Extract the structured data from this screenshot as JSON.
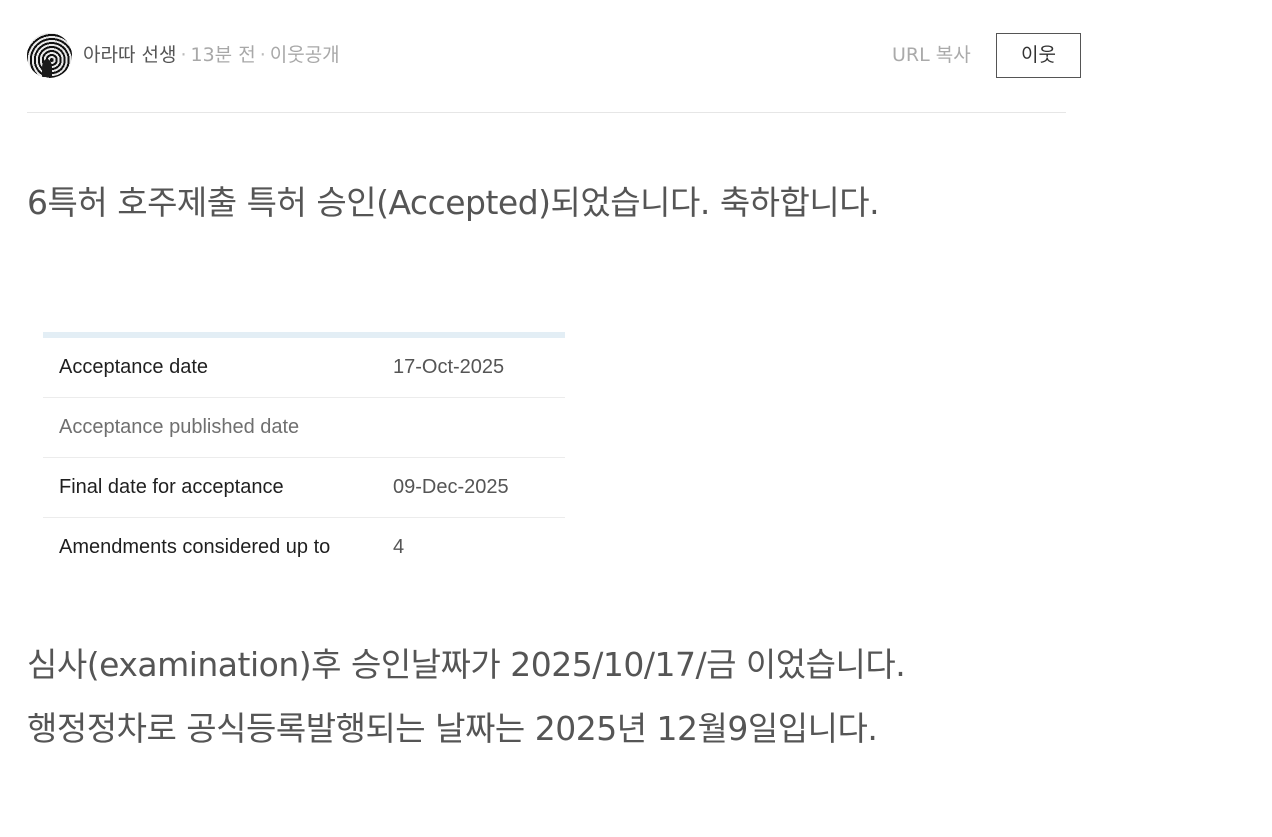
{
  "header": {
    "author": "아라따 선생",
    "time_ago": "13분 전",
    "visibility": "이웃공개",
    "url_copy_label": "URL 복사",
    "neighbor_button_label": "이웃"
  },
  "post": {
    "headline": "6특허 호주제출 특허 승인(Accepted)되었습니다. 축하합니다.",
    "table_rows": [
      {
        "label": "Acceptance date",
        "value": "17-Oct-2025"
      },
      {
        "label": "Acceptance published date",
        "value": ""
      },
      {
        "label": "Final date for acceptance",
        "value": "09-Dec-2025"
      },
      {
        "label": "Amendments considered up to",
        "value": "4"
      }
    ],
    "body_lines": [
      "심사(examination)후 승인날짜가 2025/10/17/금 이었습니다.",
      "행정정차로 공식등록발행되는 날짜는 2025년 12월9일입니다."
    ]
  },
  "colors": {
    "text": "#555555",
    "muted": "#a8a8a8",
    "table_header_bar": "#e3eef5"
  }
}
